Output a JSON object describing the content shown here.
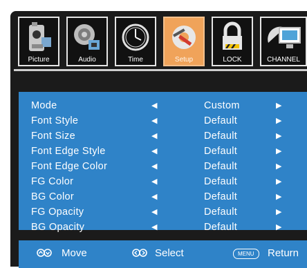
{
  "tabs": [
    {
      "label": "Picture",
      "icon": "picture-icon"
    },
    {
      "label": "Audio",
      "icon": "audio-icon"
    },
    {
      "label": "Time",
      "icon": "clock-icon"
    },
    {
      "label": "Setup",
      "icon": "setup-tools-icon",
      "active": true
    },
    {
      "label": "LOCK",
      "icon": "lock-icon"
    },
    {
      "label": "CHANNEL",
      "icon": "channel-dish-icon"
    }
  ],
  "settings": [
    {
      "label": "Mode",
      "value": "Custom"
    },
    {
      "label": "Font Style",
      "value": "Default"
    },
    {
      "label": "Font Size",
      "value": "Default"
    },
    {
      "label": "Font Edge Style",
      "value": "Default"
    },
    {
      "label": "Font Edge Color",
      "value": "Default"
    },
    {
      "label": "FG Color",
      "value": "Default"
    },
    {
      "label": "BG Color",
      "value": "Default"
    },
    {
      "label": "FG Opacity",
      "value": "Default"
    },
    {
      "label": "BG Opacity",
      "value": "Default"
    }
  ],
  "arrows": {
    "left": "◀",
    "right": "▶"
  },
  "footer": {
    "move_label": "Move",
    "select_label": "Select",
    "menu_key": "MENU",
    "return_label": "Return"
  },
  "colors": {
    "panel_blue": "#2f83c8",
    "frame": "#1b1b1b",
    "active_tab": "#f0a35a"
  }
}
